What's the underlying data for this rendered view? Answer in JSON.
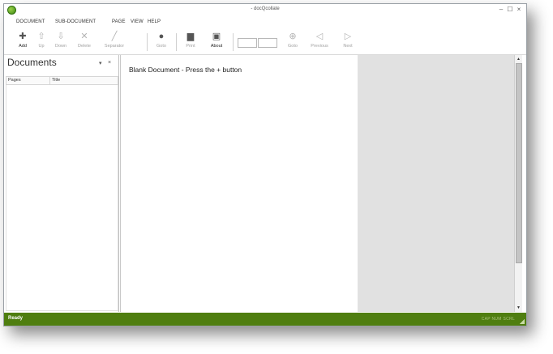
{
  "window": {
    "title": "- docQcollate",
    "controls": {
      "minimize": "–",
      "maximize": "☐",
      "close": "×"
    }
  },
  "menu": [
    "DOCUMENT",
    "SUB-DOCUMENT",
    "PAGE",
    "VIEW",
    "HELP"
  ],
  "toolbar": {
    "add": {
      "label": "Add",
      "icon": "add-icon"
    },
    "up": {
      "label": "Up",
      "icon": "arrow-up-icon"
    },
    "down": {
      "label": "Down",
      "icon": "arrow-down-icon"
    },
    "delete": {
      "label": "Delete",
      "icon": "delete-icon"
    },
    "separator": {
      "label": "Separator",
      "icon": "pen-icon"
    },
    "goto1": {
      "label": "Goto",
      "icon": "goto-icon"
    },
    "print": {
      "label": "Print",
      "icon": "print-icon"
    },
    "about": {
      "label": "About",
      "icon": "about-icon"
    },
    "goto2": {
      "label": "Goto",
      "icon": "target-icon"
    },
    "previous": {
      "label": "Previous",
      "icon": "previous-icon"
    },
    "next": {
      "label": "Next",
      "icon": "next-icon"
    }
  },
  "documents_panel": {
    "title": "Documents",
    "pin": "▾",
    "close": "×",
    "columns": [
      "Pages",
      "Title"
    ]
  },
  "content": {
    "message": "Blank Document - Press the + button"
  },
  "statusbar": {
    "status": "Ready",
    "keys": "CAP  NUM  SCRL"
  },
  "colors": {
    "status_bar": "#4f7e10",
    "app_icon": "#5aa31d"
  }
}
